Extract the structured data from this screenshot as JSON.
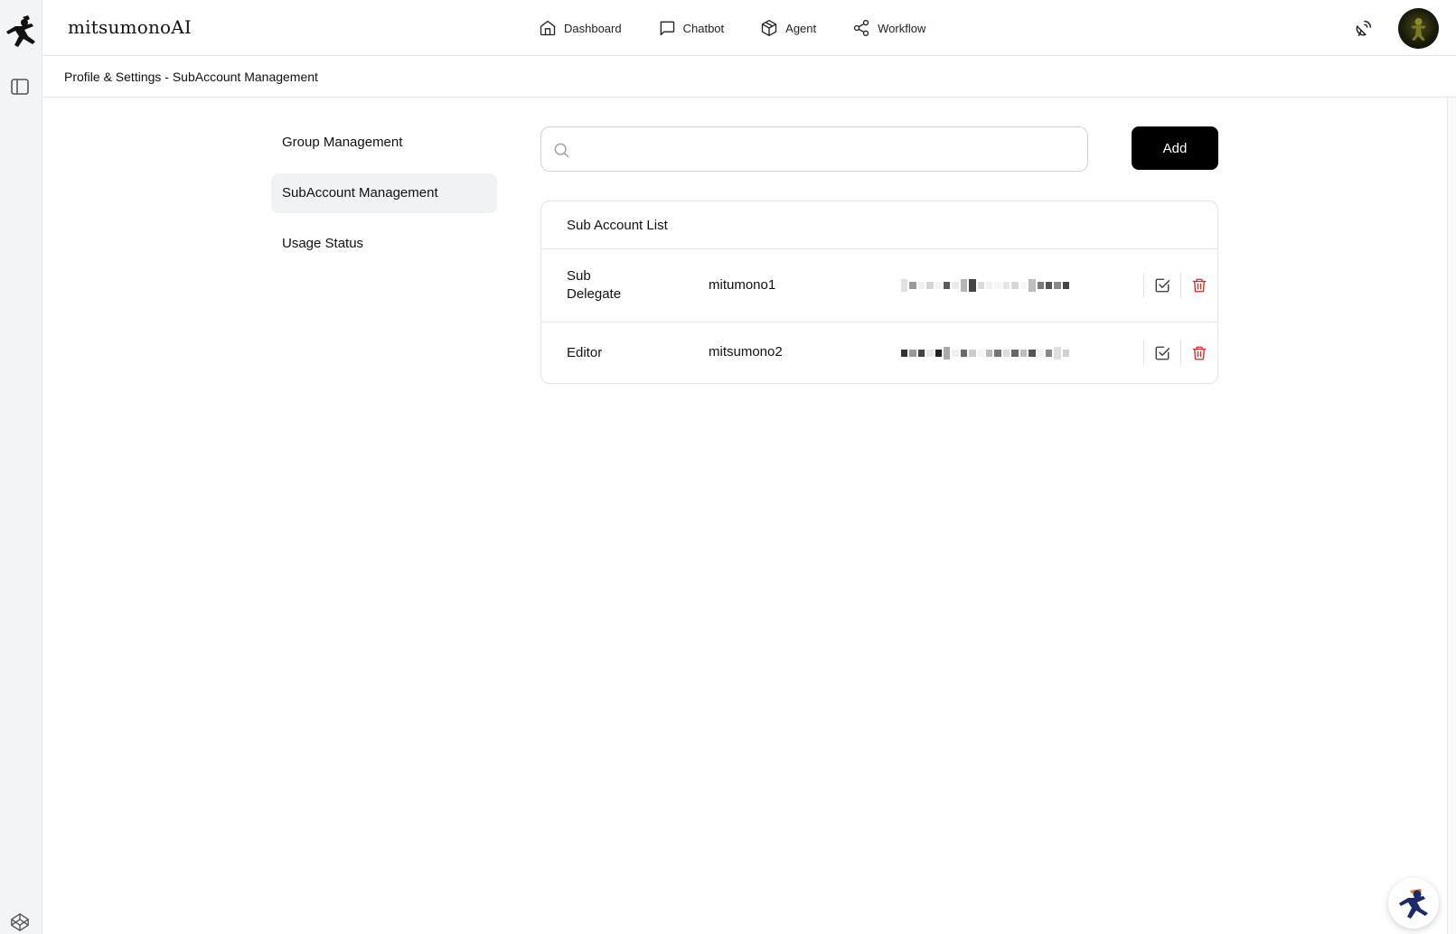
{
  "app": {
    "brand": "mitsumonoAI"
  },
  "nav": [
    {
      "label": "Dashboard",
      "icon": "home-icon"
    },
    {
      "label": "Chatbot",
      "icon": "chat-icon"
    },
    {
      "label": "Agent",
      "icon": "package-icon"
    },
    {
      "label": "Workflow",
      "icon": "share-icon"
    }
  ],
  "breadcrumb": "Profile & Settings - SubAccount Management",
  "side_menu": [
    {
      "label": "Group Management",
      "active": false
    },
    {
      "label": "SubAccount Management",
      "active": true
    },
    {
      "label": "Usage Status",
      "active": false
    }
  ],
  "search": {
    "placeholder": "",
    "value": ""
  },
  "add_label": "Add",
  "list": {
    "title": "Sub Account List",
    "rows": [
      {
        "role_line1": "Sub",
        "role_line2": "Delegate",
        "username": "mitumono1"
      },
      {
        "role_line1": "Editor",
        "role_line2": "",
        "username": "mitsumono2"
      }
    ]
  },
  "colors": {
    "primary": "#000000",
    "danger": "#dc2626",
    "active_bg": "#f1f2f4"
  }
}
